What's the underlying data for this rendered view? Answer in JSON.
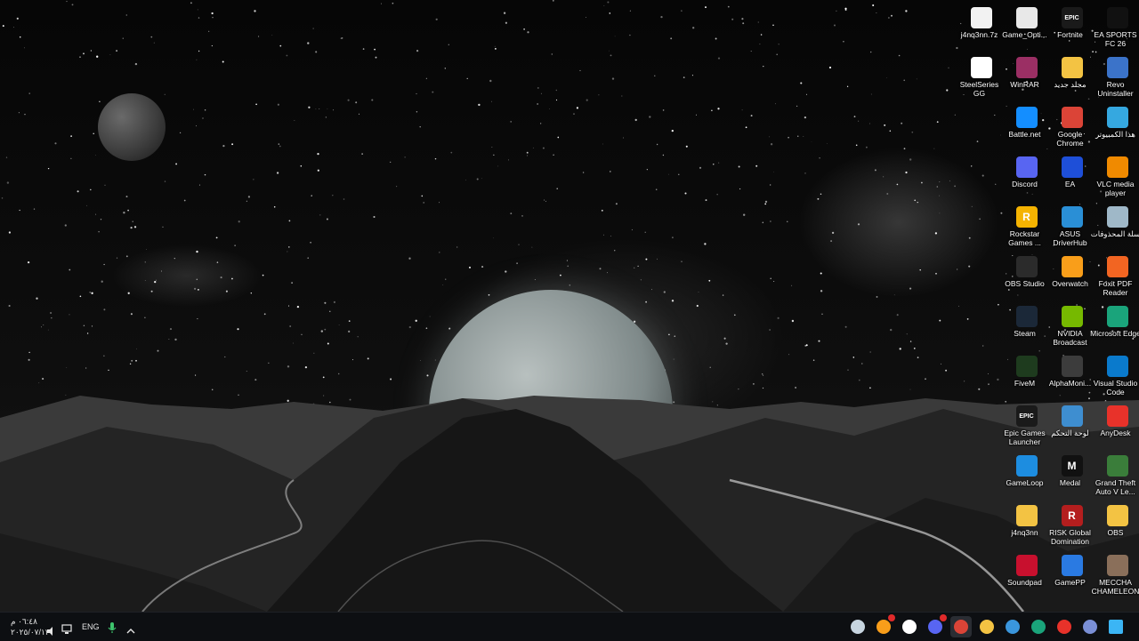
{
  "desktop": {
    "icons": [
      {
        "label": "j4nq3nn.7z",
        "icon": "file-icon",
        "color": "#f2f2f2"
      },
      {
        "label": "Game_Opti...",
        "icon": "game-optimizer-icon",
        "color": "#e8e8e8"
      },
      {
        "label": "Fortnite",
        "icon": "fortnite-icon",
        "color": "#1a1a1a",
        "glyph": "EPIC"
      },
      {
        "label": "EA SPORTS FC 26",
        "icon": "ea-sports-fc-icon",
        "color": "#111111"
      },
      {
        "label": "SteelSeries GG",
        "icon": "steelseries-icon",
        "color": "#ffffff"
      },
      {
        "label": "WinRAR",
        "icon": "winrar-icon",
        "color": "#9b2f64"
      },
      {
        "label": "مجلد جديد",
        "icon": "folder-icon",
        "color": "#f3c343"
      },
      {
        "label": "Revo Uninstaller",
        "icon": "revo-uninstaller-icon",
        "color": "#3b73c9"
      },
      {
        "label": "Battle.net",
        "icon": "battle-net-icon",
        "color": "#148eff"
      },
      {
        "label": "Google Chrome",
        "icon": "chrome-icon",
        "color": "#db4437"
      },
      {
        "label": "هذا الكمبيوتر",
        "icon": "this-pc-icon",
        "color": "#35a8e0"
      },
      {
        "label": "Discord",
        "icon": "discord-icon",
        "color": "#5865f2"
      },
      {
        "label": "EA",
        "icon": "ea-icon",
        "color": "#1e4fd8"
      },
      {
        "label": "VLC media player",
        "icon": "vlc-icon",
        "color": "#f08a00"
      },
      {
        "label": "Rockstar Games ...",
        "icon": "rockstar-icon",
        "color": "#f5b301",
        "glyph": "R"
      },
      {
        "label": "ASUS DriverHub",
        "icon": "asus-driverhub-icon",
        "color": "#2a8fd6"
      },
      {
        "label": "سلة المحذوفات",
        "icon": "recycle-bin-icon",
        "color": "#9fb8c8"
      },
      {
        "label": "OBS Studio",
        "icon": "obs-icon",
        "color": "#2b2b2b"
      },
      {
        "label": "Overwatch",
        "icon": "overwatch-icon",
        "color": "#f99e1a"
      },
      {
        "label": "Foxit PDF Reader",
        "icon": "foxit-icon",
        "color": "#f26522"
      },
      {
        "label": "Steam",
        "icon": "steam-icon",
        "color": "#1b2838"
      },
      {
        "label": "NVIDIA Broadcast",
        "icon": "nvidia-icon",
        "color": "#76b900"
      },
      {
        "label": "Microsoft Edge",
        "icon": "edge-icon",
        "color": "#1aa47b"
      },
      {
        "label": "FiveM",
        "icon": "fivem-icon",
        "color": "#1e3b1e"
      },
      {
        "label": "AlphaMoni...",
        "icon": "alphamonitor-icon",
        "color": "#3c3c3c"
      },
      {
        "label": "Visual Studio Code",
        "icon": "vscode-icon",
        "color": "#0a7acc"
      },
      {
        "label": "Epic Games Launcher",
        "icon": "epic-games-icon",
        "color": "#1a1a1a",
        "glyph": "EPIC"
      },
      {
        "label": "لوحة التحكم",
        "icon": "control-panel-icon",
        "color": "#3e8ed0"
      },
      {
        "label": "AnyDesk",
        "icon": "anydesk-icon",
        "color": "#e8322a"
      },
      {
        "label": "GameLoop",
        "icon": "gameloop-icon",
        "color": "#1d8de0"
      },
      {
        "label": "Medal",
        "icon": "medal-icon",
        "color": "#111111",
        "glyph": "M"
      },
      {
        "label": "Grand Theft Auto V Le...",
        "icon": "gta-v-icon",
        "color": "#3a7d3a"
      },
      {
        "label": "j4nq3nn",
        "icon": "folder-icon",
        "color": "#f3c343"
      },
      {
        "label": "RISK Global Domination",
        "icon": "risk-icon",
        "color": "#b41e1e",
        "glyph": "R"
      },
      {
        "label": "OBS",
        "icon": "folder-icon",
        "color": "#f3c343"
      },
      {
        "label": "Soundpad",
        "icon": "soundpad-icon",
        "color": "#c8102e"
      },
      {
        "label": "GamePP",
        "icon": "gamepp-icon",
        "color": "#2a7ae2"
      },
      {
        "label": "MECCHA CHAMELEON",
        "icon": "meccha-chameleon-icon",
        "color": "#8a6f5a"
      }
    ]
  },
  "taskbar": {
    "clock_time": "٠٦:٤٨ م",
    "clock_date": "٢٠٢٥/٠٧/١٣",
    "language": "ENG",
    "apps": [
      {
        "name": "steam",
        "icon": "steam-icon",
        "color": "#c7d5e0"
      },
      {
        "name": "overwatch",
        "icon": "overwatch-icon",
        "color": "#f99e1a",
        "badge": true
      },
      {
        "name": "medal",
        "icon": "medal-icon",
        "color": "#ffffff"
      },
      {
        "name": "discord",
        "icon": "discord-icon",
        "color": "#5865f2",
        "badge": true
      },
      {
        "name": "chrome",
        "icon": "chrome-icon",
        "color": "#db4437",
        "active": true
      },
      {
        "name": "file-explorer",
        "icon": "folder-icon",
        "color": "#f3c343"
      },
      {
        "name": "microsoft-store",
        "icon": "store-icon",
        "color": "#3a96dd"
      },
      {
        "name": "edge",
        "icon": "edge-icon",
        "color": "#1aa47b"
      },
      {
        "name": "anydesk",
        "icon": "anydesk-icon",
        "color": "#e8322a"
      },
      {
        "name": "snipping-tool",
        "icon": "snipping-tool-icon",
        "color": "#7a8fd6"
      },
      {
        "name": "start",
        "icon": "windows-start-icon",
        "color": "#3bb5f5"
      }
    ]
  }
}
